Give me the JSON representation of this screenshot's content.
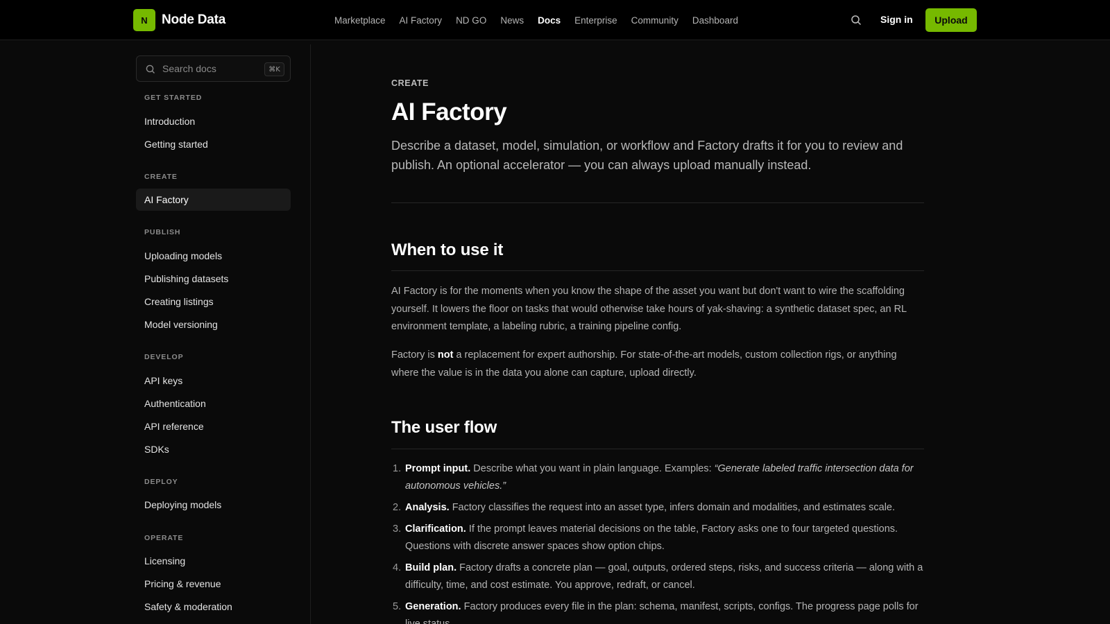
{
  "brand": {
    "logo_letter": "N",
    "name": "Node Data",
    "accent": "#76b900"
  },
  "nav": {
    "items": [
      {
        "label": "Marketplace"
      },
      {
        "label": "AI Factory"
      },
      {
        "label": "ND GO"
      },
      {
        "label": "News"
      },
      {
        "label": "Docs",
        "active": true
      },
      {
        "label": "Enterprise"
      },
      {
        "label": "Community"
      },
      {
        "label": "Dashboard"
      }
    ],
    "search_icon": "search-icon",
    "signin_label": "Sign in",
    "upload_label": "Upload"
  },
  "sidebar": {
    "search": {
      "placeholder": "Search docs",
      "shortcut": "⌘K"
    },
    "sections": [
      {
        "title": "GET STARTED",
        "items": [
          "Introduction",
          "Getting started"
        ]
      },
      {
        "title": "CREATE",
        "items": [
          "AI Factory"
        ]
      },
      {
        "title": "PUBLISH",
        "items": [
          "Uploading models",
          "Publishing datasets",
          "Creating listings",
          "Model versioning"
        ]
      },
      {
        "title": "DEVELOP",
        "items": [
          "API keys",
          "Authentication",
          "API reference",
          "SDKs"
        ]
      },
      {
        "title": "DEPLOY",
        "items": [
          "Deploying models"
        ]
      },
      {
        "title": "OPERATE",
        "items": [
          "Licensing",
          "Pricing & revenue",
          "Safety & moderation"
        ]
      }
    ],
    "active_item": "AI Factory"
  },
  "article": {
    "eyebrow": "CREATE",
    "title": "AI Factory",
    "lead": "Describe a dataset, model, simulation, or workflow and Factory drafts it for you to review and publish. An optional accelerator — you can always upload manually instead.",
    "when": {
      "heading": "When to use it",
      "p1": "AI Factory is for the moments when you know the shape of the asset you want but don't want to wire the scaffolding yourself. It lowers the floor on tasks that would otherwise take hours of yak-shaving: a synthetic dataset spec, an RL environment template, a labeling rubric, a training pipeline config.",
      "p2_pre": "Factory is ",
      "p2_bold": "not",
      "p2_post": " a replacement for expert authorship. For state-of-the-art models, custom collection rigs, or anything where the value is in the data you alone can capture, upload directly."
    },
    "flow": {
      "heading": "The user flow",
      "steps": [
        {
          "num": "1.",
          "title": "Prompt input.",
          "text": " Describe what you want in plain language. Examples: ",
          "example": "“Generate labeled traffic intersection data for autonomous vehicles.”"
        },
        {
          "num": "2.",
          "title": "Analysis.",
          "text": " Factory classifies the request into an asset type, infers domain and modalities, and estimates scale."
        },
        {
          "num": "3.",
          "title": "Clarification.",
          "text": " If the prompt leaves material decisions on the table, Factory asks one to four targeted questions. Questions with discrete answer spaces show option chips."
        },
        {
          "num": "4.",
          "title": "Build plan.",
          "text": " Factory drafts a concrete plan — goal, outputs, ordered steps, risks, and success criteria — along with a difficulty, time, and cost estimate. You approve, redraft, or cancel."
        },
        {
          "num": "5.",
          "title": "Generation.",
          "text": " Factory produces every file in the plan: schema, manifest, scripts, configs. The progress page polls for live status."
        }
      ]
    }
  }
}
